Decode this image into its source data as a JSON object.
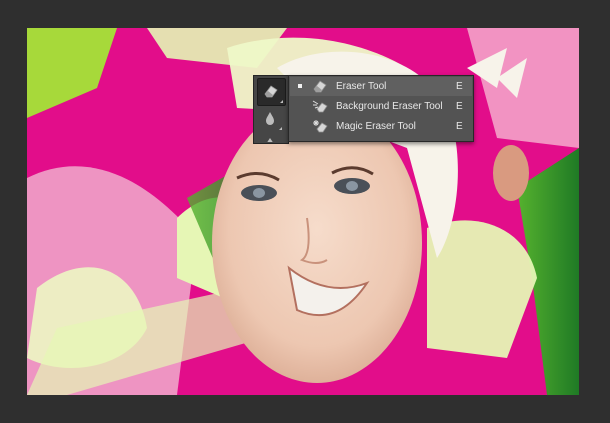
{
  "toolbar": {
    "flyout_items": [
      {
        "label": "Eraser Tool",
        "shortcut": "E",
        "selected": true,
        "icon": "eraser-icon"
      },
      {
        "label": "Background Eraser Tool",
        "shortcut": "E",
        "selected": false,
        "icon": "background-eraser-icon"
      },
      {
        "label": "Magic Eraser Tool",
        "shortcut": "E",
        "selected": false,
        "icon": "magic-eraser-icon"
      }
    ],
    "strip_tools": [
      {
        "icon": "eraser-icon",
        "active": true
      },
      {
        "icon": "blur-drop-icon",
        "active": false
      },
      {
        "icon": "dodge-icon",
        "active": false
      }
    ]
  },
  "colors": {
    "workspace": "#2f2f2f",
    "menu_bg": "#535353",
    "menu_highlight": "#606060",
    "art_magenta": "#e20d8a",
    "art_lime": "#e8f7b8",
    "art_green": "#2e8b2a"
  }
}
